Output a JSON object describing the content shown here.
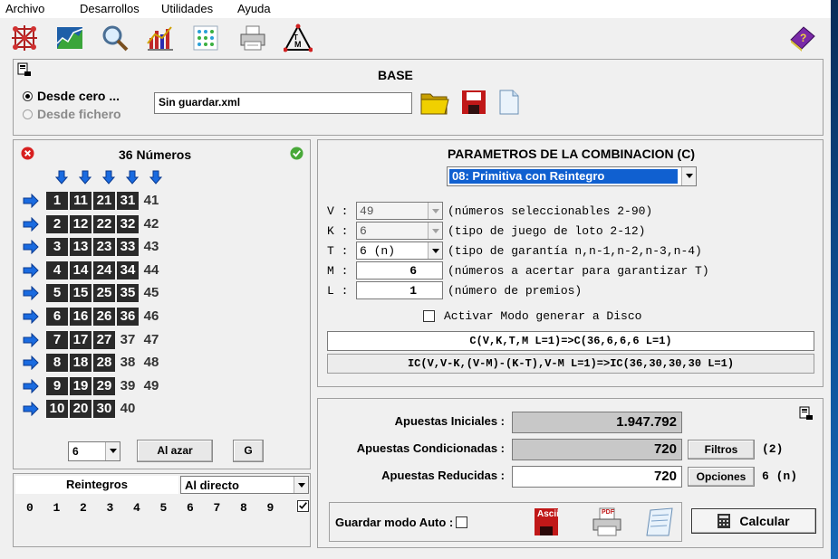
{
  "menu": [
    "Archivo",
    "Desarrollos",
    "Utilidades",
    "Ayuda"
  ],
  "toolbar_icons": [
    "network-icon",
    "chart-icon",
    "magnifier-icon",
    "bar-chart-icon",
    "dots-matrix-icon",
    "printer-icon",
    "tm-triangle-icon",
    "help-book-icon"
  ],
  "base": {
    "title": "BASE",
    "radio_desde_cero": "Desde cero ...",
    "radio_desde_fichero": "Desde fichero",
    "filename": "Sin guardar.xml"
  },
  "numbers": {
    "title": "36 Números",
    "rows": [
      {
        "cells": [
          {
            "v": "1",
            "d": true
          },
          {
            "v": "11",
            "d": true
          },
          {
            "v": "21",
            "d": true
          },
          {
            "v": "31",
            "d": true
          },
          {
            "v": "41",
            "d": false
          }
        ]
      },
      {
        "cells": [
          {
            "v": "2",
            "d": true
          },
          {
            "v": "12",
            "d": true
          },
          {
            "v": "22",
            "d": true
          },
          {
            "v": "32",
            "d": true
          },
          {
            "v": "42",
            "d": false
          }
        ]
      },
      {
        "cells": [
          {
            "v": "3",
            "d": true
          },
          {
            "v": "13",
            "d": true
          },
          {
            "v": "23",
            "d": true
          },
          {
            "v": "33",
            "d": true
          },
          {
            "v": "43",
            "d": false
          }
        ]
      },
      {
        "cells": [
          {
            "v": "4",
            "d": true
          },
          {
            "v": "14",
            "d": true
          },
          {
            "v": "24",
            "d": true
          },
          {
            "v": "34",
            "d": true
          },
          {
            "v": "44",
            "d": false
          }
        ]
      },
      {
        "cells": [
          {
            "v": "5",
            "d": true
          },
          {
            "v": "15",
            "d": true
          },
          {
            "v": "25",
            "d": true
          },
          {
            "v": "35",
            "d": true
          },
          {
            "v": "45",
            "d": false
          }
        ]
      },
      {
        "cells": [
          {
            "v": "6",
            "d": true
          },
          {
            "v": "16",
            "d": true
          },
          {
            "v": "26",
            "d": true
          },
          {
            "v": "36",
            "d": true
          },
          {
            "v": "46",
            "d": false
          }
        ]
      },
      {
        "cells": [
          {
            "v": "7",
            "d": true
          },
          {
            "v": "17",
            "d": true
          },
          {
            "v": "27",
            "d": true
          },
          {
            "v": "37",
            "d": false
          },
          {
            "v": "47",
            "d": false
          }
        ]
      },
      {
        "cells": [
          {
            "v": "8",
            "d": true
          },
          {
            "v": "18",
            "d": true
          },
          {
            "v": "28",
            "d": true
          },
          {
            "v": "38",
            "d": false
          },
          {
            "v": "48",
            "d": false
          }
        ]
      },
      {
        "cells": [
          {
            "v": "9",
            "d": true
          },
          {
            "v": "19",
            "d": true
          },
          {
            "v": "29",
            "d": true
          },
          {
            "v": "39",
            "d": false
          },
          {
            "v": "49",
            "d": false
          }
        ]
      },
      {
        "cells": [
          {
            "v": "10",
            "d": true
          },
          {
            "v": "20",
            "d": true
          },
          {
            "v": "30",
            "d": true
          },
          {
            "v": "40",
            "d": false
          }
        ]
      }
    ],
    "count_select": "6",
    "btn_al_azar": "Al azar",
    "btn_g": "G"
  },
  "reintegros": {
    "header": "Reintegros",
    "mode": "Al directo",
    "digits": [
      "0",
      "1",
      "2",
      "3",
      "4",
      "5",
      "6",
      "7",
      "8",
      "9"
    ],
    "checked": true
  },
  "params": {
    "title": "PARAMETROS DE LA COMBINACION (C)",
    "game": "08: Primitiva con Reintegro",
    "rows": [
      {
        "key": "V :",
        "value": "49",
        "desc": "(números seleccionables 2-90)",
        "kind": "combo-disabled"
      },
      {
        "key": "K :",
        "value": "6",
        "desc": "(tipo de juego de loto 2-12)",
        "kind": "combo-disabled"
      },
      {
        "key": "T :",
        "value": "6 (n)",
        "desc": "(tipo de garantía n,n-1,n-2,n-3,n-4)",
        "kind": "combo"
      },
      {
        "key": "M :",
        "value": "6",
        "desc": "(números a acertar para garantizar T)",
        "kind": "input"
      },
      {
        "key": "L :",
        "value": "1",
        "desc": "(número de premios)",
        "kind": "input"
      }
    ],
    "disk_mode": "Activar Modo generar a Disco",
    "formula_c": "C(V,K,T,M L=1)=>C(36,6,6,6 L=1)",
    "formula_ic": "IC(V,V-K,(V-M)-(K-T),V-M L=1)=>IC(36,30,30,30 L=1)"
  },
  "results": {
    "apuestas_iniciales_label": "Apuestas Iniciales :",
    "apuestas_iniciales": "1.947.792",
    "apuestas_condicionadas_label": "Apuestas Condicionadas :",
    "apuestas_condicionadas": "720",
    "filtros_btn": "Filtros",
    "filtros_count": "(2)",
    "apuestas_reducidas_label": "Apuestas Reducidas :",
    "apuestas_reducidas": "720",
    "opciones_btn": "Opciones",
    "opciones_val": "6 (n)",
    "guardar_auto": "Guardar modo Auto :",
    "ascii_label": "Ascii",
    "pdf_label": "PDF",
    "calcular_btn": "Calcular"
  }
}
